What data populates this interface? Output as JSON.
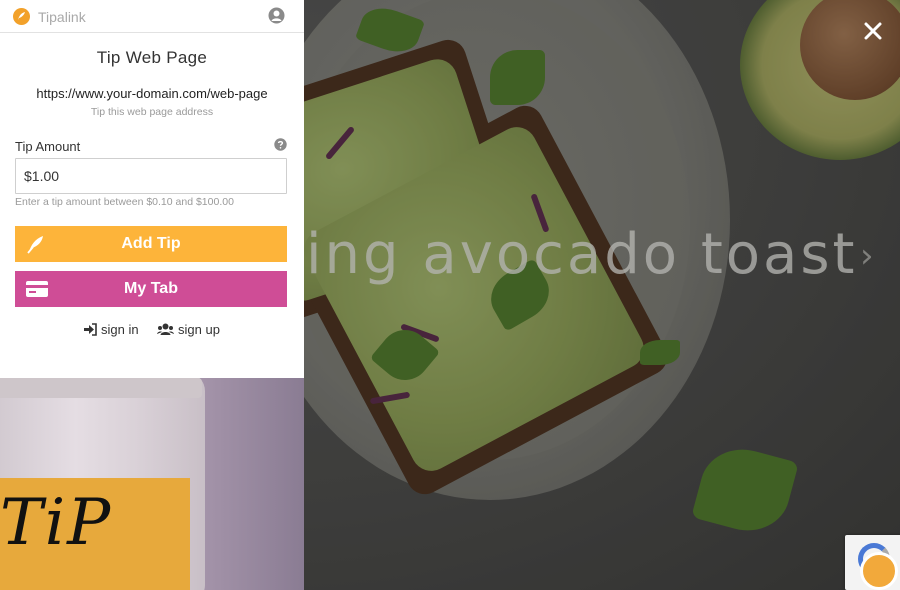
{
  "app": {
    "name": "Tipalink"
  },
  "panel": {
    "title": "Tip Web Page",
    "url": "https://www.your-domain.com/web-page",
    "url_hint": "Tip this web page address",
    "amount": {
      "label": "Tip Amount",
      "value": "$1.00",
      "hint": "Enter a tip amount between $0.10 and $100.00"
    },
    "buttons": {
      "add_tip": "Add Tip",
      "my_tab": "My Tab"
    },
    "auth": {
      "sign_in": "sign in",
      "sign_up": "sign up"
    }
  },
  "hero": {
    "caption": "ing avocado toast",
    "next_glyph": "›"
  },
  "jar": {
    "label_text": "TiP"
  },
  "colors": {
    "brand_orange": "#f2a12a",
    "add_tip": "#fdb43a",
    "my_tab": "#cf4d96"
  },
  "icons": {
    "brand": "tipalink-logo-icon",
    "user": "user-circle-icon",
    "help": "question-circle-icon",
    "add_tip": "feather-icon",
    "my_tab": "credit-card-icon",
    "sign_in": "sign-in-icon",
    "sign_up": "users-icon",
    "close": "close-icon",
    "next": "chevron-right-icon"
  }
}
